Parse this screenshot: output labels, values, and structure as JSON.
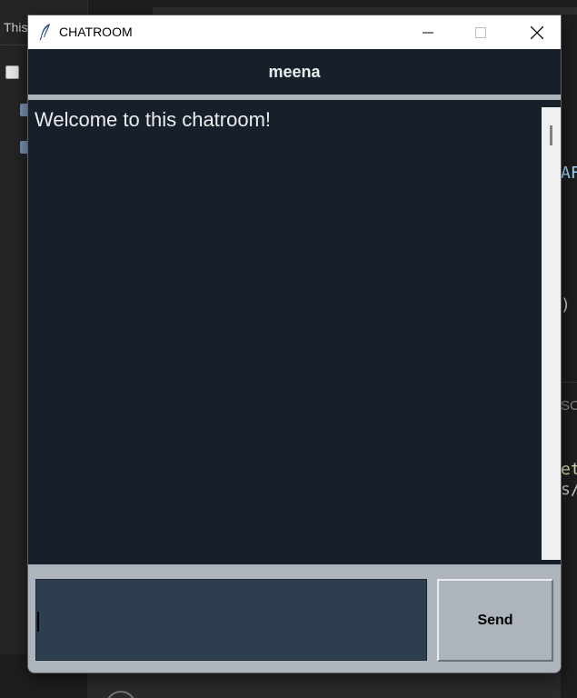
{
  "background": {
    "left_tab_label": "This",
    "right_fragments": [
      "AF",
      ")",
      "SC",
      "et",
      "s/"
    ]
  },
  "window": {
    "title": "CHATROOM",
    "header_name": "meena",
    "chat_messages": [
      "Welcome to this chatroom!"
    ],
    "input_value": "",
    "send_label": "Send"
  },
  "colors": {
    "dark_bg": "#17202a",
    "input_bg": "#2c3e50",
    "frame_grey": "#aeb4bb",
    "text_light": "#eaecee"
  }
}
